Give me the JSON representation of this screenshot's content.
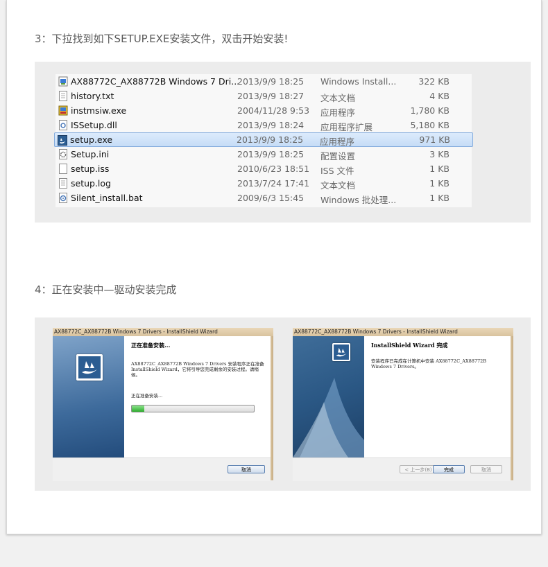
{
  "step3": {
    "title": "3：下拉找到如下SETUP.EXE安装文件，双击开始安装!"
  },
  "files": [
    {
      "name": "AX88772C_AX88772B Windows 7 Dri...",
      "date": "2013/9/9 18:25",
      "type": "Windows Install...",
      "size": "322 KB",
      "icon": "msi-icon",
      "selected": false
    },
    {
      "name": "history.txt",
      "date": "2013/9/9 18:27",
      "type": "文本文档",
      "size": "4 KB",
      "icon": "text-file-icon",
      "selected": false
    },
    {
      "name": "instmsiw.exe",
      "date": "2004/11/28 9:53",
      "type": "应用程序",
      "size": "1,780 KB",
      "icon": "installer-exe-icon",
      "selected": false
    },
    {
      "name": "ISSetup.dll",
      "date": "2013/9/9 18:24",
      "type": "应用程序扩展",
      "size": "5,180 KB",
      "icon": "dll-icon",
      "selected": false
    },
    {
      "name": "setup.exe",
      "date": "2013/9/9 18:25",
      "type": "应用程序",
      "size": "971 KB",
      "icon": "setup-exe-icon",
      "selected": true
    },
    {
      "name": "Setup.ini",
      "date": "2013/9/9 18:25",
      "type": "配置设置",
      "size": "3 KB",
      "icon": "ini-icon",
      "selected": false
    },
    {
      "name": "setup.iss",
      "date": "2010/6/23 18:51",
      "type": "ISS 文件",
      "size": "1 KB",
      "icon": "blank-file-icon",
      "selected": false
    },
    {
      "name": "setup.log",
      "date": "2013/7/24 17:41",
      "type": "文本文档",
      "size": "1 KB",
      "icon": "text-file-icon",
      "selected": false
    },
    {
      "name": "Silent_install.bat",
      "date": "2009/6/3 15:45",
      "type": "Windows 批处理...",
      "size": "1 KB",
      "icon": "bat-icon",
      "selected": false
    }
  ],
  "step4": {
    "title": "4：正在安装中—驱动安装完成"
  },
  "wizard1": {
    "window_title": "AX88772C_AX88772B Windows 7 Drivers - InstallShield Wizard",
    "heading": "正在准备安装...",
    "description": "AX88772C_AX88772B Windows 7 Drivers 安装程序正在准备 InstallShield Wizard，它将引导您完成剩余的安装过程。请稍候。",
    "status": "正在准备安装...",
    "progress_percent": 10,
    "cancel_label": "取消"
  },
  "wizard2": {
    "window_title": "AX88772C_AX88772B Windows 7 Drivers - InstallShield Wizard",
    "heading": "InstallShield Wizard 完成",
    "description": "安装程序已完成在计算机中安装 AX88772C_AX88772B Windows 7 Drivers。",
    "back_label": "< 上一步(B)",
    "finish_label": "完成",
    "cancel_label": "取消"
  }
}
